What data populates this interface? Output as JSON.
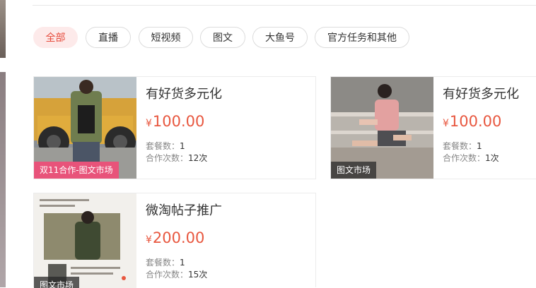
{
  "filters": [
    {
      "label": "全部",
      "active": true
    },
    {
      "label": "直播",
      "active": false
    },
    {
      "label": "短视频",
      "active": false
    },
    {
      "label": "图文",
      "active": false
    },
    {
      "label": "大鱼号",
      "active": false
    },
    {
      "label": "官方任务和其他",
      "active": false
    }
  ],
  "cards": [
    {
      "title": "有好货多元化",
      "currency": "¥",
      "price": "100.00",
      "badge": "双11合作-图文市场",
      "packages_label": "套餐数：",
      "packages_value": "1",
      "coop_label": "合作次数：",
      "coop_value": "12次"
    },
    {
      "title": "有好货多元化",
      "currency": "¥",
      "price": "100.00",
      "badge": "图文市场",
      "packages_label": "套餐数：",
      "packages_value": "1",
      "coop_label": "合作次数：",
      "coop_value": "1次"
    },
    {
      "title": "微淘帖子推广",
      "currency": "¥",
      "price": "200.00",
      "badge": "图文市场",
      "packages_label": "套餐数：",
      "packages_value": "1",
      "coop_label": "合作次数：",
      "coop_value": "15次"
    }
  ],
  "colors": {
    "accent": "#e8573f",
    "active_chip_bg": "#fdeaea",
    "badge_pink": "#e8537a"
  }
}
